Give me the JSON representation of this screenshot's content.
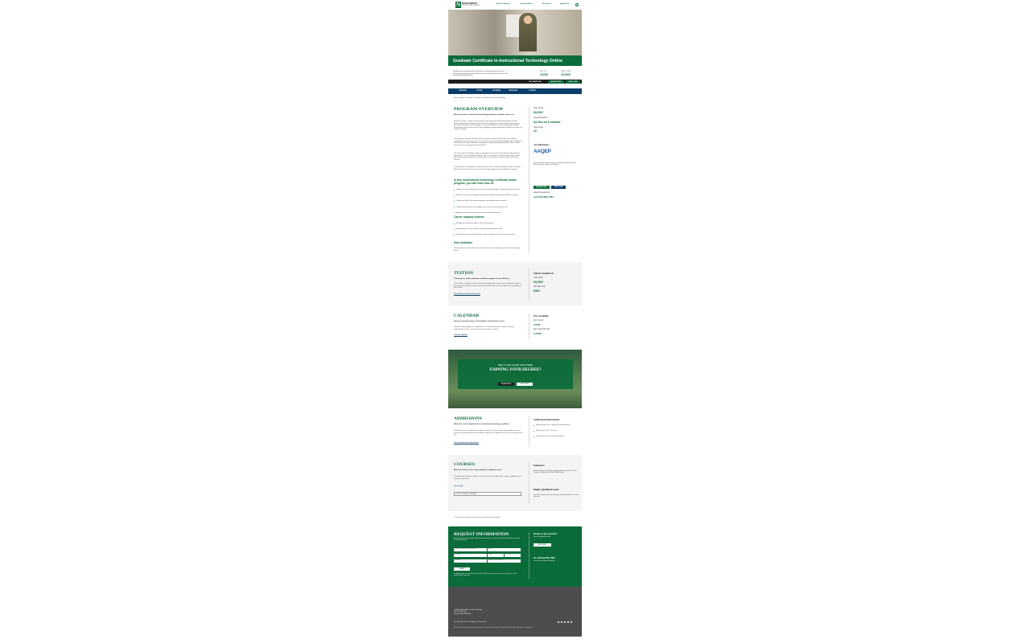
{
  "header": {
    "logo_title": "NORTHWEST",
    "logo_subtitle": "MISSOURI STATE UNIVERSITY",
    "nav": [
      "Online Programs",
      "Getting Started",
      "Resources",
      "Apply Now"
    ]
  },
  "hero": {
    "title": "Graduate Certificate in Instructional Technology Online"
  },
  "intro": {
    "text": "Integrate new technology into instruction or training materials and create effective learning experiences. Research in successful online instruction and sound instructional practice.",
    "apply_by_label": "APPLY BY",
    "apply_by": "1/2/25",
    "start_label": "START CLASS",
    "start": "1/13/25",
    "phone": "CALL 844-890-7084",
    "request_btn": "REQUEST INFO",
    "apply_btn": "APPLY NOW"
  },
  "subnav": [
    "OVERVIEW",
    "TUITION",
    "CALENDAR",
    "ADMISSIONS",
    "COURSES"
  ],
  "breadcrumb": "Home  >  Programs  >  Graduate  >  Graduate Certificate in Instructional Technology",
  "overview": {
    "heading": "PROGRAM OVERVIEW",
    "subheading": "What our online instructional technology graduate certificate offers you",
    "p1": "Become a leader in online and instructional technology with the Northwest Missouri State University Graduate Certificate in Instructional Technology. In this specialized online program, you will develop skills and knowledge in using technology to enhance teaching and training, design instructional materials and create engaging learning experiences for diverse learners in a variety of settings.",
    "p2": "This program is ideal for professionals in education, business, government and nonprofit organizations who want to learn how to make the most of instructional design and technology for teaching and training. Graduates are prepared to apply technology effectively in their current roles or pursue new opportunities in the field.",
    "p3": "The instructional technology certificate supplements your instructional design and instruction knowledge. Courses are offered entirely online. Our faculty has experience teaching in many different education and business settings and ensure that the curriculum stays current and relevant.",
    "p4": "Credits earned in the program can be transferred into the Northwest Missouri State University Master of Science in Education in Instructional Technology - Teaching Emphasis program.",
    "learn_heading": "In this instructional technology certificate online program, you will learn how to:",
    "learn": [
      "Identify concepts and practices used in instructional design to improve learning outcomes",
      "Evaluate and select technology and learning platforms that support effective instruction",
      "Design and deliver instructional programs that engage diverse learners",
      "Develop assessments and strategies that measure learner performance",
      "Apply research-based practices to online and blended learning"
    ],
    "career_heading": "Career impacts include:",
    "career": [
      "Building your leadership skills in instructional design",
      "Expanding your career options in training and development roles",
      "Improving your teaching effectiveness with technology in the classroom and online"
    ],
    "also_heading": "Also available:",
    "also_text": "Northwest Missouri State University also offers a master's degree in instructional technology online."
  },
  "sidebar": {
    "total_tuition_label": "TOTAL TUITION",
    "total_tuition": "$4,692*",
    "duration_label": "PROGRAM DURATION",
    "duration": "As few as 8 months",
    "credit_label": "CREDIT HOURS",
    "credit": "12",
    "accred_heading": "Accreditations:",
    "accred_logo": "AAQEP",
    "accred_text": "Northwest Missouri State University is accredited by the Association for Advancing Quality in Educator Preparation.",
    "request_btn": "REQUEST INFO",
    "apply_btn": "APPLY NOW",
    "speak_label": "SPEAK WITH AN ADVISOR",
    "speak_phone": "Call 844-890-7084"
  },
  "tuition": {
    "heading": "TUITION",
    "subheading": "Choosing our online graduate certificate program is cost-effective",
    "text": "The Graduate Certificate in Instructional Technology online program offers affordable tuition for online learners, making it easy to advance your education and career goals without putting your life on hold.",
    "link": "View additional tuition information",
    "side_heading": "Tuition breakdown:",
    "total_label": "TOTAL TUITION",
    "total": "$4,692*",
    "per_label": "PER CREDIT HOUR",
    "per": "$391"
  },
  "calendar": {
    "heading": "CALENDAR",
    "subheading": "View the upcoming dates and deadlines for Northwest online",
    "text": "Northwest online programs are delivered in an accelerated format made for working professionals, so you can start learning sooner than you think.",
    "link": "View the calendar",
    "side_heading": "Now enrolling:",
    "apply_label": "APPLY DATE BY",
    "apply": "1/2/25",
    "start_label": "NEXT CLASS START DATE",
    "start": "1/13/25"
  },
  "cta": {
    "line1": "READY TO TAKE THE NEXT STEPS TOWARD",
    "line2": "EARNING YOUR DEGREE?",
    "request_btn": "REQUEST INFO",
    "apply_btn": "APPLY NOW"
  },
  "admissions": {
    "heading": "ADMISSIONS",
    "subheading": "What you need to apply for the instructional technology certificate",
    "text": "At Northwest, we are dedicated to making it easier for students to get started. Applicants must meet the requirements listed to be admitted. Submit your application and our team will work with you.",
    "link": "View all admission requirements",
    "side_heading": "Admission Requirements:",
    "reqs": [
      "Bachelor's degree from a regionally accredited institution",
      "GPA of at least 2.75 on a 4.0 scale",
      "Official transcripts from all institutions attended"
    ]
  },
  "courses": {
    "heading": "COURSES",
    "subheading": "What you'll learn in our online graduate certificate course",
    "text": "The Northwest Graduate Certificate in Instructional Technology online requires completion of 12 semester credit hours.",
    "select_label": "Courses (4)",
    "select_value": "CORE COURSES (12 HOURS)",
    "ranked_heading": "Ranked #1",
    "ranked_text": "Northwest Missouri State University was ranked among the Best Online Programs in Missouri by US News & World Report.",
    "faculty_heading": "Highly Qualified Faculty",
    "faculty_text": "Learn from experienced faculty who bring real-world expertise to the online classroom."
  },
  "disclaimer": "* Tuition and fees are subject to change. Please see the catalog for current information.",
  "request": {
    "heading": "REQUEST INFORMATION",
    "text": "Submit this form and an Enrollment Specialist will contact you to answer any questions and guide you through the enrollment process.",
    "program_label": "Program of Interest",
    "fields": [
      "Graduate Certificate in Instructional Tech",
      "Email*",
      "First Name*",
      "Phone*",
      "ZIP Code*",
      "Last Name*",
      "How did you hear about us?"
    ],
    "submit": "SUBMIT",
    "fine": "By submitting this form, I agree that Northwest Missouri State University and its representatives may contact me via phone, text or email regarding educational opportunities.",
    "ready_heading": "Ready to get started?",
    "ready_text": "Start your application today.",
    "apply_btn": "APPLY NOW",
    "call_heading": "Or call 844-890-7084",
    "call_text": "to talk with an Enrollment Specialist."
  },
  "footer": {
    "address": "© 2024 Northwest Missouri State University\n800 University Drive\nMaryville, MO 64468 USA",
    "links": "Privacy Policy  |  Terms & Conditions  |  Cookie Policy",
    "fine": "Northwest Missouri State University is accredited by the Higher Learning Commission. Northwest has engaged Academic Partnerships to help support its online programs."
  },
  "colors": {
    "brand": "#0b6b3a",
    "navy": "#0b3d69",
    "footer": "#4d4d4d"
  }
}
